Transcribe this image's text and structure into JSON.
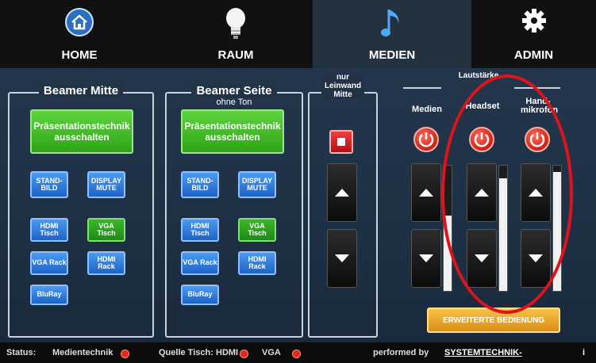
{
  "tabs": [
    {
      "label": "HOME",
      "icon": "home-icon"
    },
    {
      "label": "RAUM",
      "icon": "lightbulb-icon"
    },
    {
      "label": "MEDIEN",
      "icon": "music-note-icon"
    },
    {
      "label": "ADMIN",
      "icon": "gear-icon"
    }
  ],
  "beamer_mitte": {
    "title": "Beamer Mitte",
    "off_label": "Präsentationstechnik ausschalten",
    "standbild": "STAND-BILD",
    "display_mute": "DISPLAY MUTE",
    "hdmi_tisch": "HDMI Tisch",
    "vga_tisch": "VGA Tisch",
    "vga_rack": "VGA Rack",
    "hdmi_rack": "HDMI Rack",
    "bluray": "BluRay"
  },
  "beamer_seite": {
    "title": "Beamer Seite",
    "subtitle": "ohne Ton",
    "off_label": "Präsentationstechnik ausschalten",
    "standbild": "STAND-BILD",
    "display_mute": "DISPLAY MUTE",
    "hdmi_tisch": "HDMI Tisch",
    "vga_tisch": "VGA Tisch",
    "vga_rack": "VGA Rack",
    "hdmi_rack": "HDMI Rack",
    "bluray": "BluRay"
  },
  "leinwand": {
    "title_1": "nur",
    "title_2": "Leinwand",
    "title_3": "Mitte"
  },
  "lautstaerke": {
    "title": "Lautstärke",
    "channels": [
      {
        "label": "Medien",
        "level": 0.6
      },
      {
        "label": "Headset",
        "level": 0.9
      },
      {
        "label": "Hand-mikrofon",
        "level": 0.95
      }
    ],
    "advanced_label": "ERWEITERTE BEDIENUNG"
  },
  "status": {
    "status_label": "Status:",
    "medientechnik": "Medientechnik",
    "quelle_label": "Quelle Tisch:",
    "hdmi": "HDMI",
    "vga": "VGA",
    "performed_by": "performed by",
    "company": "SYSTEMTECHNIK-"
  },
  "colors": {
    "accent_red": "#e0131b",
    "green": "#3db52a",
    "blue": "#2f7fe0",
    "orange": "#f0a72a"
  }
}
